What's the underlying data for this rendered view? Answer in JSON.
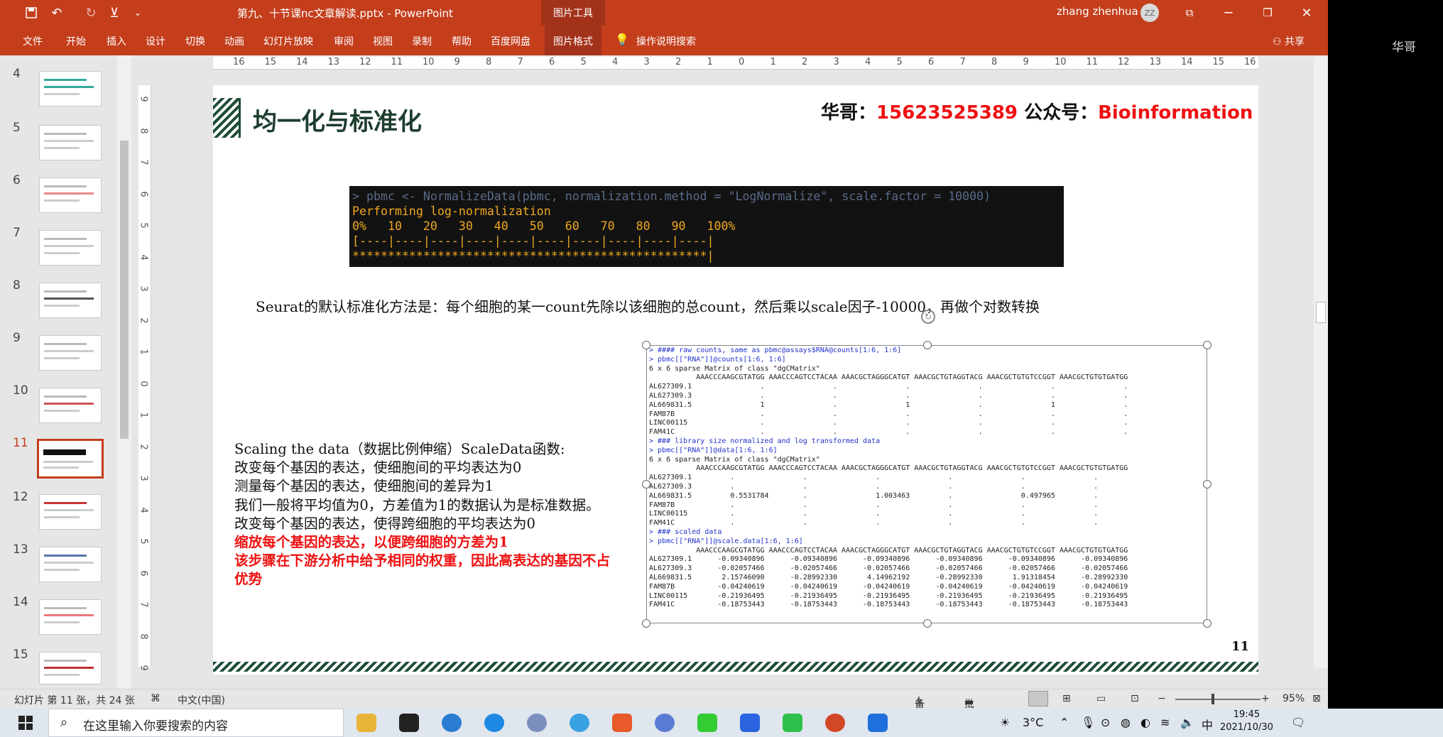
{
  "window": {
    "title": "第九、十节课nc文章解读.pptx  -  PowerPoint",
    "context_tool": "图片工具",
    "user": "zhang zhenhua",
    "user_initials": "ZZ"
  },
  "ribbon_tabs": [
    "文件",
    "开始",
    "插入",
    "设计",
    "切换",
    "动画",
    "幻灯片放映",
    "审阅",
    "视图",
    "录制",
    "帮助",
    "百度网盘",
    "图片格式"
  ],
  "tell_me": "操作说明搜索",
  "share": "共享",
  "side_label": "华哥",
  "thumbnails": [
    "4",
    "5",
    "6",
    "7",
    "8",
    "9",
    "10",
    "11",
    "12",
    "13",
    "14",
    "15"
  ],
  "current_thumb": "11",
  "ruler_h": [
    "16",
    "15",
    "14",
    "13",
    "12",
    "11",
    "10",
    "9",
    "8",
    "7",
    "6",
    "5",
    "4",
    "3",
    "2",
    "1",
    "0",
    "1",
    "2",
    "3",
    "4",
    "5",
    "6",
    "7",
    "8",
    "9",
    "10",
    "11",
    "12",
    "13",
    "14",
    "15",
    "16"
  ],
  "ruler_v": [
    "9",
    "8",
    "7",
    "6",
    "5",
    "4",
    "3",
    "2",
    "1",
    "0",
    "1",
    "2",
    "3",
    "4",
    "5",
    "6",
    "7",
    "8",
    "9"
  ],
  "slide": {
    "title": "均一化与标准化",
    "contact_prefix": "华哥：",
    "phone": "15623525389",
    "contact_mid": " 公众号：",
    "account": "Bioinformation",
    "code_cmd": "> pbmc <- NormalizeData(pbmc, normalization.method = \"LogNormalize\", scale.factor = 10000)",
    "code_lines": [
      "Performing log-normalization",
      "0%   10   20   30   40   50   60   70   80   90   100%",
      "[----|----|----|----|----|----|----|----|----|----|",
      "**************************************************|"
    ],
    "description": "Seurat的默认标准化方法是：每个细胞的某一count先除以该细胞的总count，然后乘以scale因子-10000，再做个对数转换",
    "scaling_lines": [
      "Scaling the data（数据比例伸缩）ScaleData函数:",
      "改变每个基因的表达，使细胞间的平均表达为0",
      "测量每个基因的表达，使细胞间的差异为1",
      "我们一般将平均值为0，方差值为1的数据认为是标准数据。",
      "改变每个基因的表达，使得跨细胞的平均表达为0"
    ],
    "scaling_red": [
      "缩放每个基因的表达，以便跨细胞的方差为1",
      "该步骤在下游分析中给予相同的权重，因此高表达的基因不占优势"
    ],
    "r_output": [
      {
        "t": "> #### raw counts, same as pbmc@assays$RNA@counts[1:6, 1:6]",
        "c": "blue"
      },
      {
        "t": "> pbmc[[\"RNA\"]]@counts[1:6, 1:6]",
        "c": "blue"
      },
      {
        "t": "6 x 6 sparse Matrix of class \"dgCMatrix\"",
        "c": ""
      },
      {
        "t": "           AAACCCAAGCGTATGG AAACCCAGTCCTACAA AAACGCTAGGGCATGT AAACGCTGTAGGTACG AAACGCTGTGTCCGGT AAACGCTGTGTGATGG",
        "c": ""
      },
      {
        "t": "AL627309.1                .                .                .                .                .                .",
        "c": ""
      },
      {
        "t": "AL627309.3                .                .                .                .                .                .",
        "c": ""
      },
      {
        "t": "AL669831.5                1                .                1                .                1                .",
        "c": ""
      },
      {
        "t": "FAM87B                    .                .                .                .                .                .",
        "c": ""
      },
      {
        "t": "LINC00115                 .                .                .                .                .                .",
        "c": ""
      },
      {
        "t": "FAM41C                    .                .                .                .                .                .",
        "c": ""
      },
      {
        "t": "> ### library size normalized and log transformed data",
        "c": "blue"
      },
      {
        "t": "> pbmc[[\"RNA\"]]@data[1:6, 1:6]",
        "c": "blue"
      },
      {
        "t": "6 x 6 sparse Matrix of class \"dgCMatrix\"",
        "c": ""
      },
      {
        "t": "           AAACCCAAGCGTATGG AAACCCAGTCCTACAA AAACGCTAGGGCATGT AAACGCTGTAGGTACG AAACGCTGTGTCCGGT AAACGCTGTGTGATGG",
        "c": ""
      },
      {
        "t": "AL627309.1         .                .                .                .                .                .",
        "c": ""
      },
      {
        "t": "AL627309.3         .                .                .                .                .                .",
        "c": ""
      },
      {
        "t": "AL669831.5         0.5531784        .                1.003463         .                0.497965         .",
        "c": ""
      },
      {
        "t": "FAM87B             .                .                .                .                .                .",
        "c": ""
      },
      {
        "t": "LINC00115          .                .                .                .                .                .",
        "c": ""
      },
      {
        "t": "FAM41C             .                .                .                .                .                .",
        "c": ""
      },
      {
        "t": "> ### scaled data",
        "c": "blue"
      },
      {
        "t": "> pbmc[[\"RNA\"]]@scale.data[1:6, 1:6]",
        "c": "blue"
      },
      {
        "t": "           AAACCCAAGCGTATGG AAACCCAGTCCTACAA AAACGCTAGGGCATGT AAACGCTGTAGGTACG AAACGCTGTGTCCGGT AAACGCTGTGTGATGG",
        "c": ""
      },
      {
        "t": "AL627309.1      -0.09340896      -0.09340896      -0.09340896      -0.09340896      -0.09340896      -0.09340896",
        "c": ""
      },
      {
        "t": "AL627309.3      -0.02057466      -0.02057466      -0.02057466      -0.02057466      -0.02057466      -0.02057466",
        "c": ""
      },
      {
        "t": "AL669831.5       2.15746090      -0.28992330       4.14962192      -0.28992330       1.91318454      -0.28992330",
        "c": ""
      },
      {
        "t": "FAM87B          -0.04240619      -0.04240619      -0.04240619      -0.04240619      -0.04240619      -0.04240619",
        "c": ""
      },
      {
        "t": "LINC00115       -0.21936495      -0.21936495      -0.21936495      -0.21936495      -0.21936495      -0.21936495",
        "c": ""
      },
      {
        "t": "FAM41C          -0.18753443      -0.18753443      -0.18753443      -0.18753443      -0.18753443      -0.18753443",
        "c": ""
      }
    ],
    "page_number": "11"
  },
  "status": {
    "slide_info": "幻灯片 第 11 张，共 24 张",
    "language": "中文(中国)",
    "notes": "备注",
    "comments": "批注",
    "zoom": "95%"
  },
  "taskbar": {
    "search_placeholder": "在这里输入你要搜索的内容",
    "temperature": "3°C",
    "ime": "中",
    "time": "19:45",
    "date": "2021/10/30"
  },
  "colors": {
    "accent": "#c43e1c",
    "slide_green": "#1e4d38",
    "highlight_red": "#ee1111"
  }
}
